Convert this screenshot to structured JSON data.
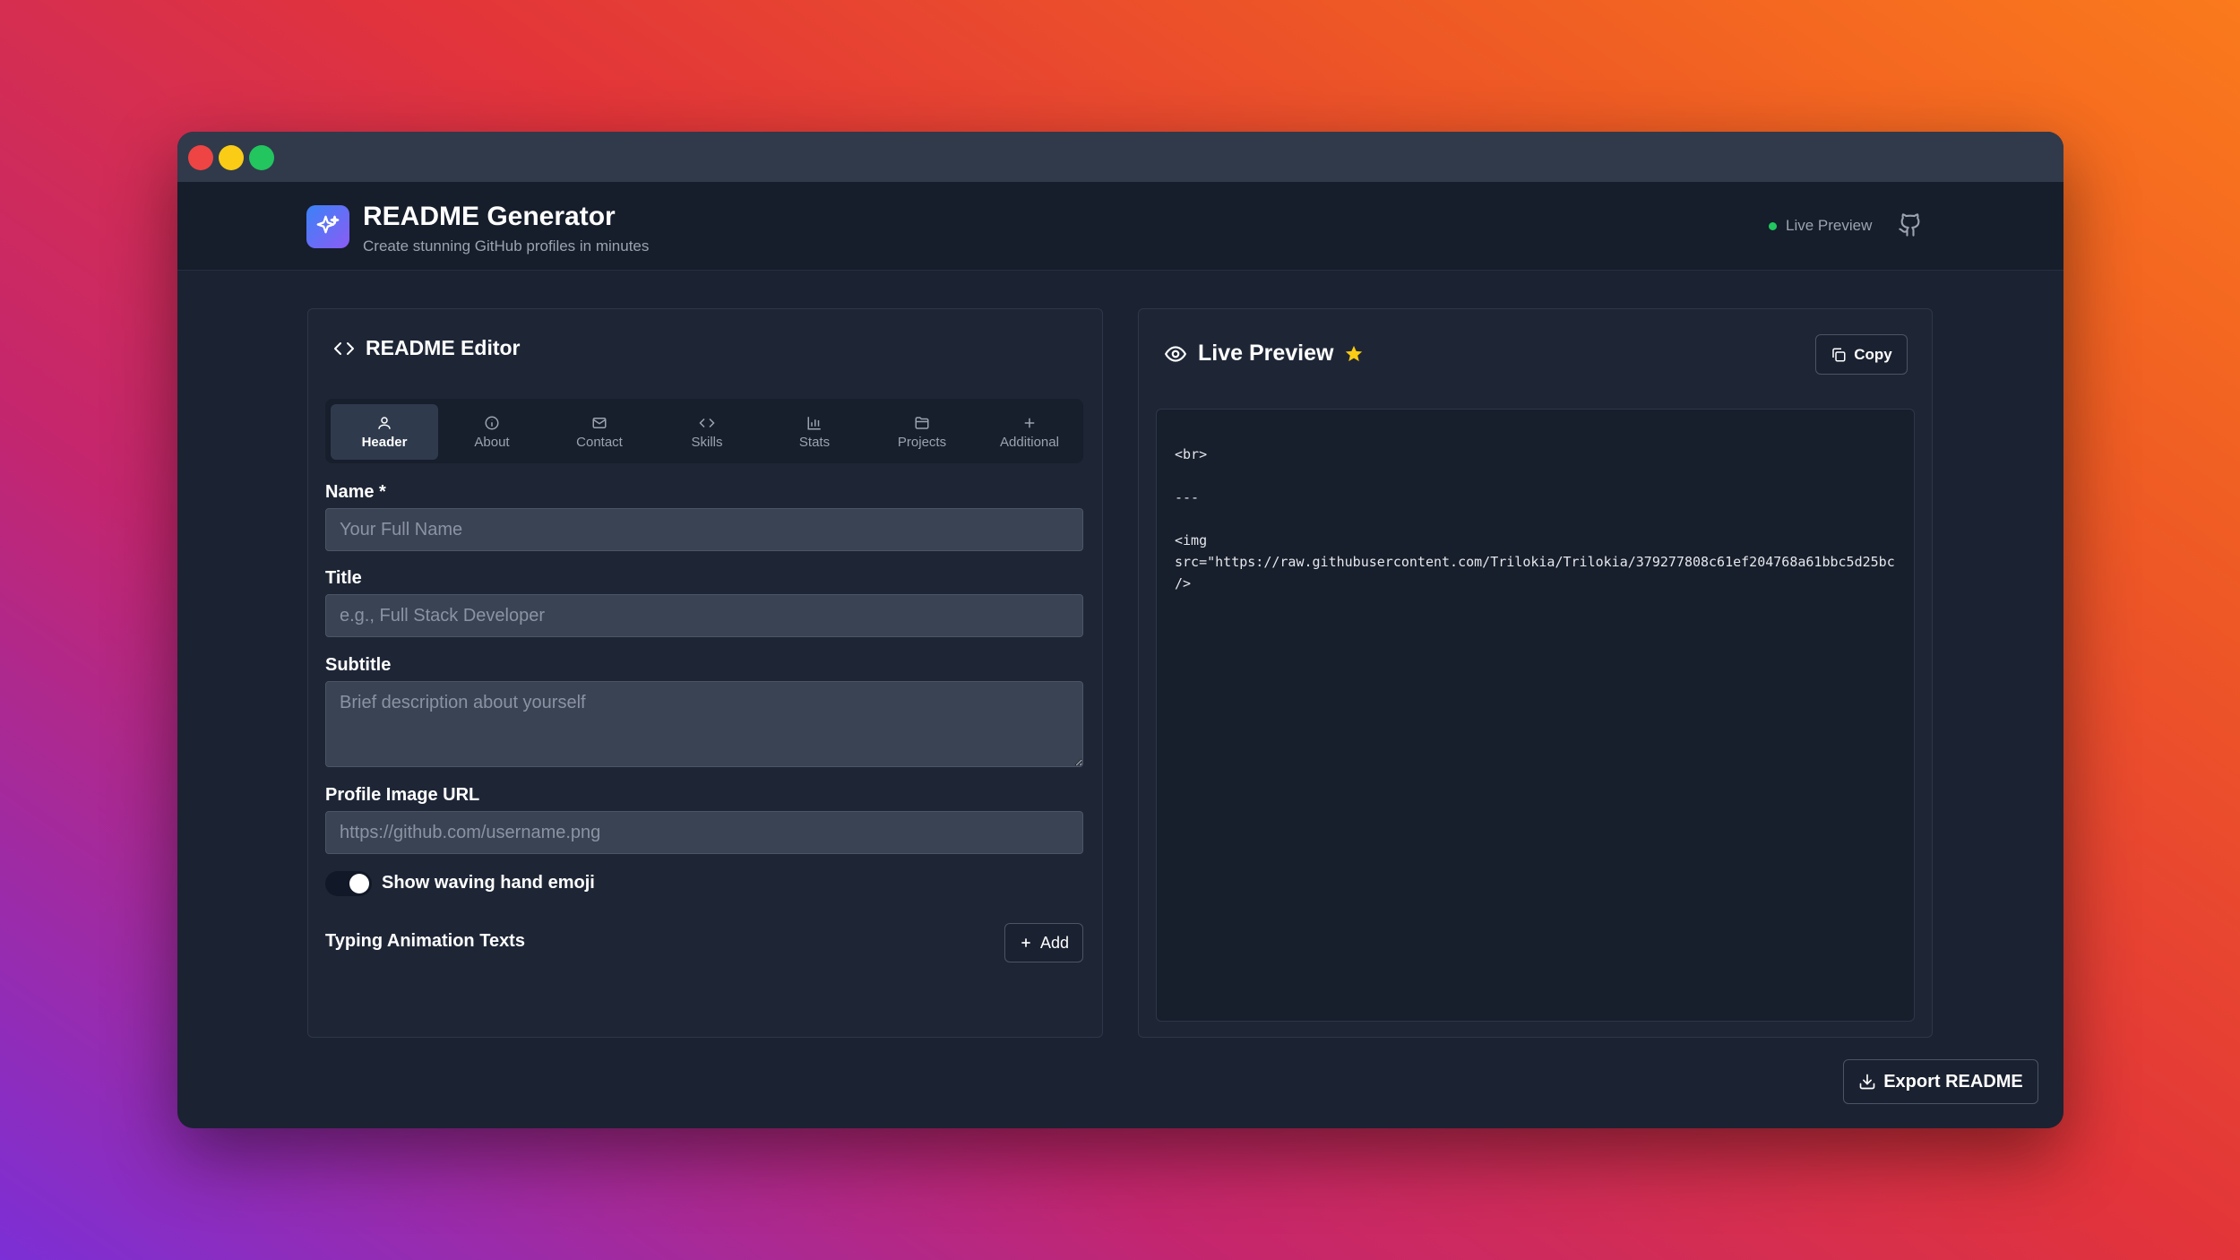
{
  "window": {
    "controls": [
      "close",
      "minimize",
      "maximize"
    ]
  },
  "app": {
    "title": "README Generator",
    "subtitle": "Create stunning GitHub profiles in minutes",
    "live_status": "Live Preview",
    "logo_icon": "sparkles-icon",
    "github_icon": "github-icon"
  },
  "editor": {
    "title": "README Editor",
    "tabs": [
      {
        "label": "Header",
        "icon": "user-icon",
        "active": true
      },
      {
        "label": "About",
        "icon": "info-icon",
        "active": false
      },
      {
        "label": "Contact",
        "icon": "mail-icon",
        "active": false
      },
      {
        "label": "Skills",
        "icon": "code-icon",
        "active": false
      },
      {
        "label": "Stats",
        "icon": "bar-chart-icon",
        "active": false
      },
      {
        "label": "Projects",
        "icon": "folder-icon",
        "active": false
      },
      {
        "label": "Additional",
        "icon": "plus-icon",
        "active": false
      }
    ],
    "fields": {
      "name": {
        "label": "Name *",
        "value": "",
        "placeholder": "Your Full Name"
      },
      "title": {
        "label": "Title",
        "value": "",
        "placeholder": "e.g., Full Stack Developer"
      },
      "subtitle": {
        "label": "Subtitle",
        "value": "",
        "placeholder": "Brief description about yourself"
      },
      "profile_image": {
        "label": "Profile Image URL",
        "value": "",
        "placeholder": "https://github.com/username.png"
      }
    },
    "toggle": {
      "label": "Show waving hand emoji",
      "on": true
    },
    "typing": {
      "label": "Typing Animation Texts",
      "add_label": "Add"
    }
  },
  "preview": {
    "title": "Live Preview",
    "copy_label": "Copy",
    "code_lines": [
      "<br>",
      "",
      "---",
      "",
      "<img",
      "src=\"https://raw.githubusercontent.com/Trilokia/Trilokia/379277808c61ef204768a61bbc5d25bc",
      "/>"
    ]
  },
  "export_label": "Export README",
  "colors": {
    "accent_star": "#facc15",
    "status_dot": "#22c55e",
    "panel_bg": "#1e2636",
    "window_bg": "#1b2232"
  }
}
